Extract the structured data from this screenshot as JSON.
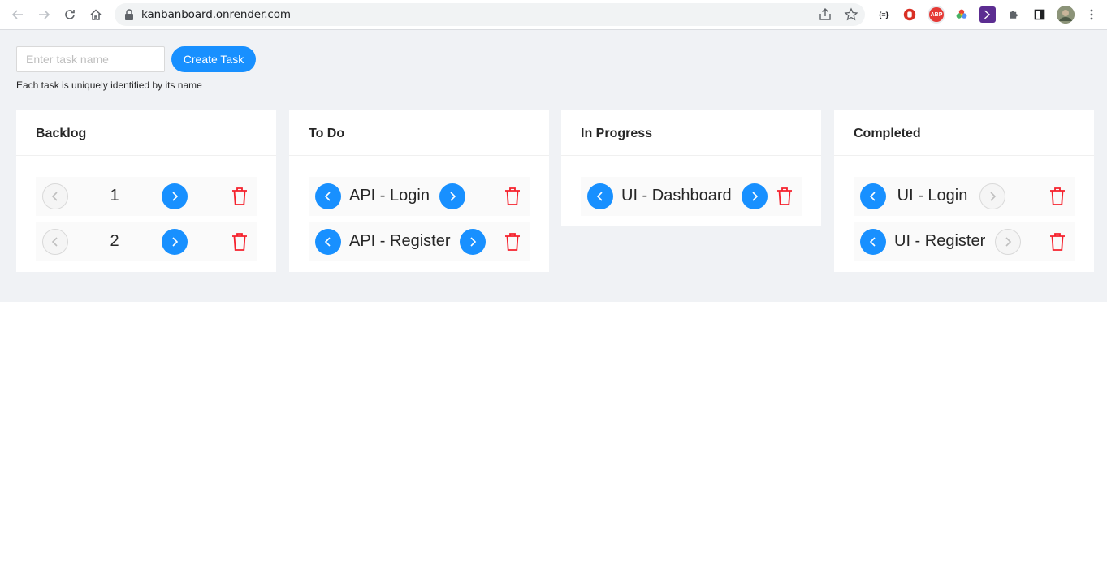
{
  "browser": {
    "url": "kanbanboard.onrender.com",
    "extensions": [
      "json-viewer-icon",
      "stop-icon",
      "adblock-icon",
      "color-wheel-icon",
      "kotlin-icon",
      "puzzle-icon",
      "sidepanel-icon",
      "profile-avatar"
    ],
    "ext_abp_label": "ABP",
    "ext_json_label": "{≡}"
  },
  "create": {
    "placeholder": "Enter task name",
    "button_label": "Create Task",
    "hint": "Each task is uniquely identified by its name"
  },
  "colors": {
    "primary": "#1890ff",
    "danger": "#f5222d",
    "background": "#f0f2f5"
  },
  "columns": [
    {
      "title": "Backlog",
      "tasks": [
        {
          "name": "1",
          "can_back": false,
          "can_forward": true
        },
        {
          "name": "2",
          "can_back": false,
          "can_forward": true
        }
      ]
    },
    {
      "title": "To Do",
      "tasks": [
        {
          "name": "API - Login",
          "can_back": true,
          "can_forward": true
        },
        {
          "name": "API - Register",
          "can_back": true,
          "can_forward": true
        }
      ]
    },
    {
      "title": "In Progress",
      "tasks": [
        {
          "name": "UI - Dashboard",
          "can_back": true,
          "can_forward": true
        }
      ]
    },
    {
      "title": "Completed",
      "tasks": [
        {
          "name": "UI - Login",
          "can_back": true,
          "can_forward": false
        },
        {
          "name": "UI - Register",
          "can_back": true,
          "can_forward": false
        }
      ]
    }
  ]
}
